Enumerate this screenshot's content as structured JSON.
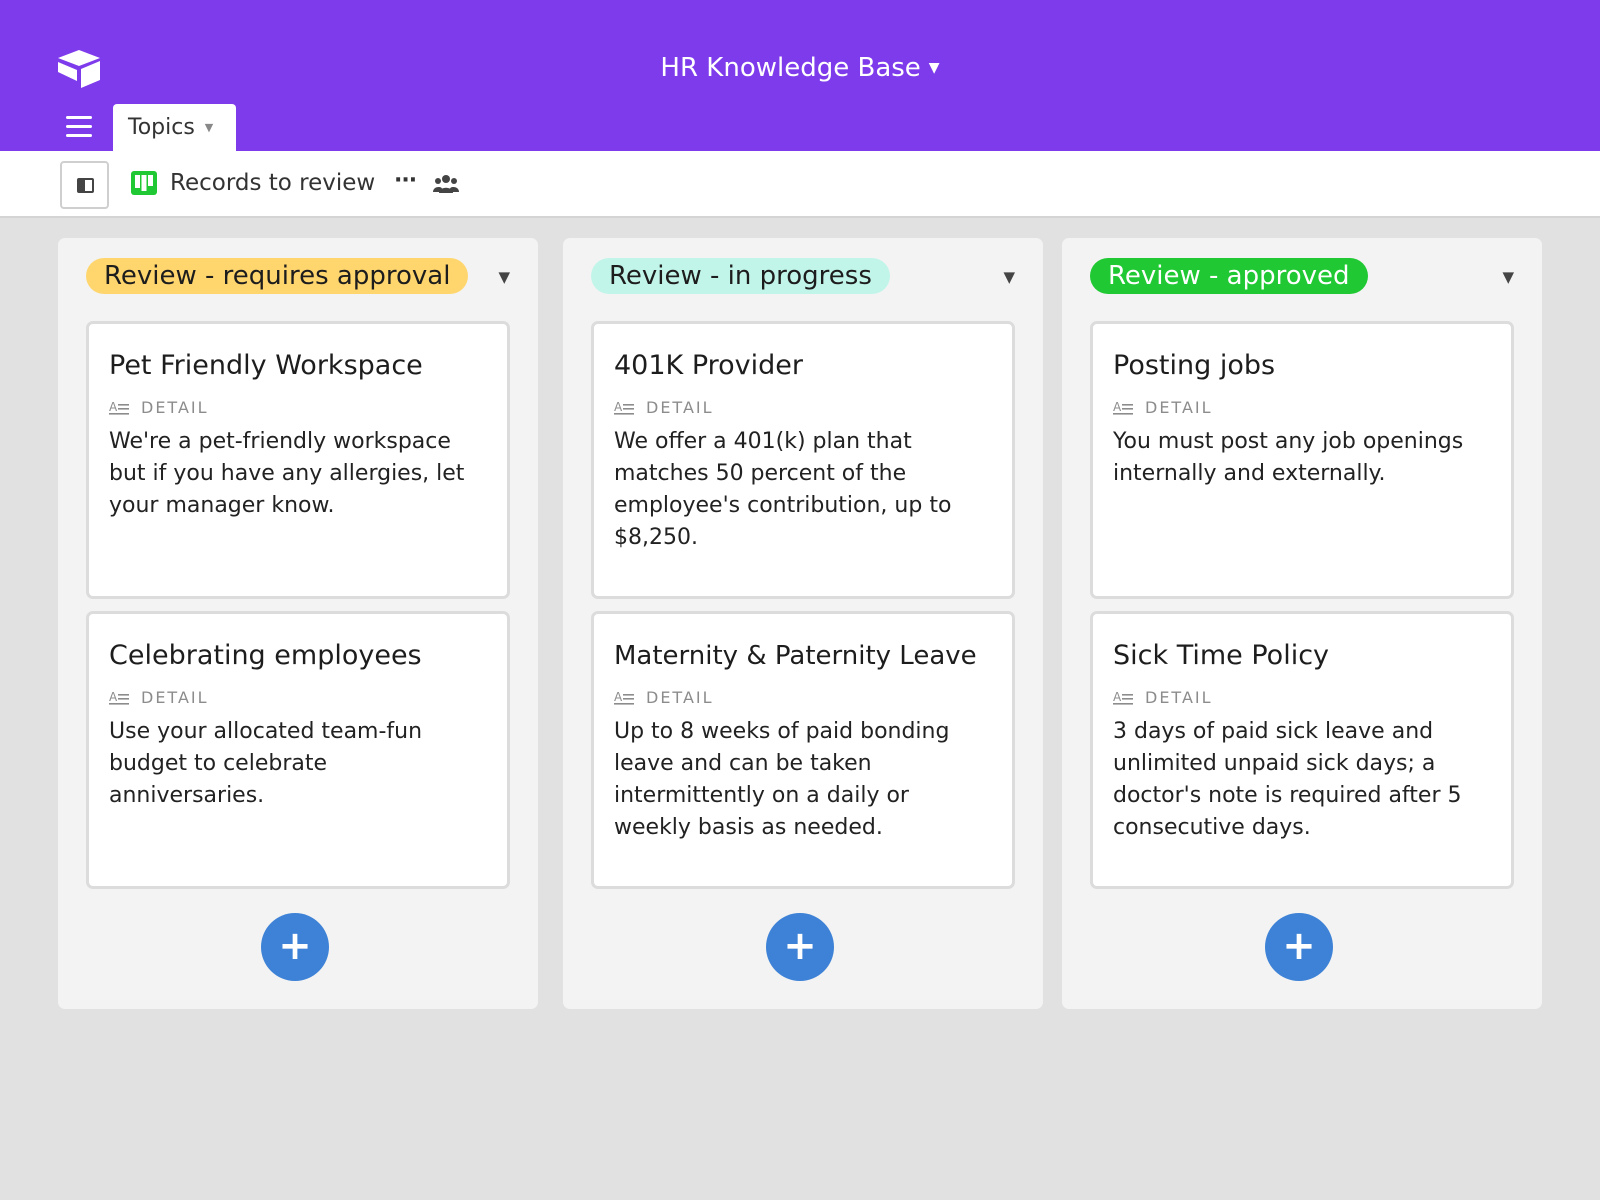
{
  "app": {
    "base_title": "HR Knowledge Base",
    "table_tab": "Topics",
    "view_name": "Records to review"
  },
  "field_label": "DETAIL",
  "stacks": [
    {
      "label": "Review - requires approval",
      "color": "#ffd66e",
      "text_color": "#1d1d1d",
      "cards": [
        {
          "title": "Pet Friendly Workspace",
          "detail": "We're a pet-friendly workspace but if you have any allergies, let your manager know."
        },
        {
          "title": "Celebrating employees",
          "detail": "Use your allocated team-fun budget to celebrate anniversaries."
        }
      ]
    },
    {
      "label": "Review - in progress",
      "color": "#c2f5e9",
      "text_color": "#1d1d1d",
      "cards": [
        {
          "title": "401K Provider",
          "detail": "We offer a 401(k) plan that matches 50 percent of the employee's contribution, up to $8,250."
        },
        {
          "title": "Maternity & Paternity Leave",
          "detail": "Up to 8 weeks of paid bonding leave and can be taken intermittently on a daily or weekly basis as needed."
        }
      ]
    },
    {
      "label": "Review - approved",
      "color": "#20c933",
      "text_color": "#ffffff",
      "cards": [
        {
          "title": "Posting jobs",
          "detail": "You must post any job openings internally and externally."
        },
        {
          "title": "Sick Time Policy",
          "detail": "3 days of paid sick leave and unlimited unpaid sick days; a doctor's note is required after 5 consecutive days."
        }
      ]
    }
  ],
  "colors": {
    "header": "#7e3bec",
    "add_button": "#3d82d6",
    "kanban_icon": "#20c933"
  },
  "icons": {
    "logo": "airtable-logo",
    "menu": "menu-icon",
    "sidebar": "sidebar-toggle-icon",
    "view": "kanban-icon",
    "more": "more-icon",
    "share": "people-icon",
    "field": "long-text-icon",
    "add": "plus-icon"
  }
}
